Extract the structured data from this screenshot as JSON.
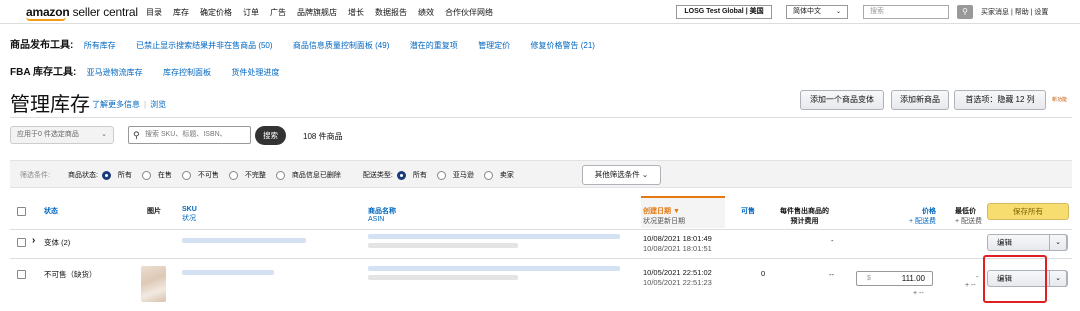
{
  "header": {
    "logo_bold": "amazon",
    "logo_rest": "seller central",
    "nav": [
      "目录",
      "库存",
      "确定价格",
      "订单",
      "广告",
      "品牌旗舰店",
      "增长",
      "数据报告",
      "绩效",
      "合作伙伴网络"
    ],
    "account": "LOSG Test Global | 美国",
    "language": "简体中文",
    "search_placeholder": "搜索",
    "links": "买家消息 | 帮助 | 设置"
  },
  "tools": {
    "listing_label": "商品发布工具:",
    "listing_links": [
      "所有库存",
      "已禁止显示搜索结果并非在售商品 (50)",
      "商品信息质量控制面板 (49)",
      "潜在的重复项",
      "管理定价",
      "修复价格警告 (21)"
    ],
    "fba_label": "FBA 库存工具:",
    "fba_links": [
      "亚马逊物流库存",
      "库存控制面板",
      "货件处理进度"
    ]
  },
  "page": {
    "title": "管理库存",
    "learn_more": "了解更多信息",
    "tour": "浏览",
    "add_variation": "添加一个商品变体",
    "add_product": "添加新商品",
    "preferences": "首选项：隐藏 12 列",
    "new_feature": "新功能"
  },
  "bulk": {
    "action": "应用于0 件选定商品",
    "search_placeholder": "搜索 SKU、标题、ISBN、",
    "search_button": "搜索",
    "count": "108 件商品"
  },
  "filters": {
    "label": "筛选条件:",
    "status_label": "商品状态:",
    "status_options": [
      "所有",
      "在售",
      "不可售",
      "不完整",
      "商品信息已删除"
    ],
    "status_selected": 0,
    "fulfill_label": "配送类型:",
    "fulfill_options": [
      "所有",
      "亚马逊",
      "卖家"
    ],
    "fulfill_selected": 0,
    "more_button": "其他筛选条件"
  },
  "table": {
    "headers": {
      "status": "状态",
      "image": "图片",
      "sku": "SKU",
      "condition": "状况",
      "name": "商品名称",
      "asin": "ASIN",
      "date_created": "创建日期 ▼",
      "date_updated": "状况更新日期",
      "available": "可售",
      "fee_l1": "每件售出商品的",
      "fee_l2": "预计费用",
      "price": "价格",
      "price_plus": "+ 配送费",
      "min_price": "最低价",
      "min_plus": "+ 配送费",
      "save_all": "保存所有"
    },
    "rows": [
      {
        "status": "变体 (2)",
        "date1": "10/08/2021 18:01:49",
        "date2": "10/08/2021 18:01:51",
        "available": "",
        "fee": "",
        "price_dash": "-",
        "edit": "编辑"
      },
      {
        "status": "不可售（缺货）",
        "date1": "10/05/2021 22:51:02",
        "date2": "10/05/2021 22:51:23",
        "available": "0",
        "fee": "--",
        "currency": "$",
        "price": "111.00",
        "ship": "+ --",
        "min": "-",
        "min_ship": "+ --",
        "edit": "编辑"
      }
    ]
  }
}
